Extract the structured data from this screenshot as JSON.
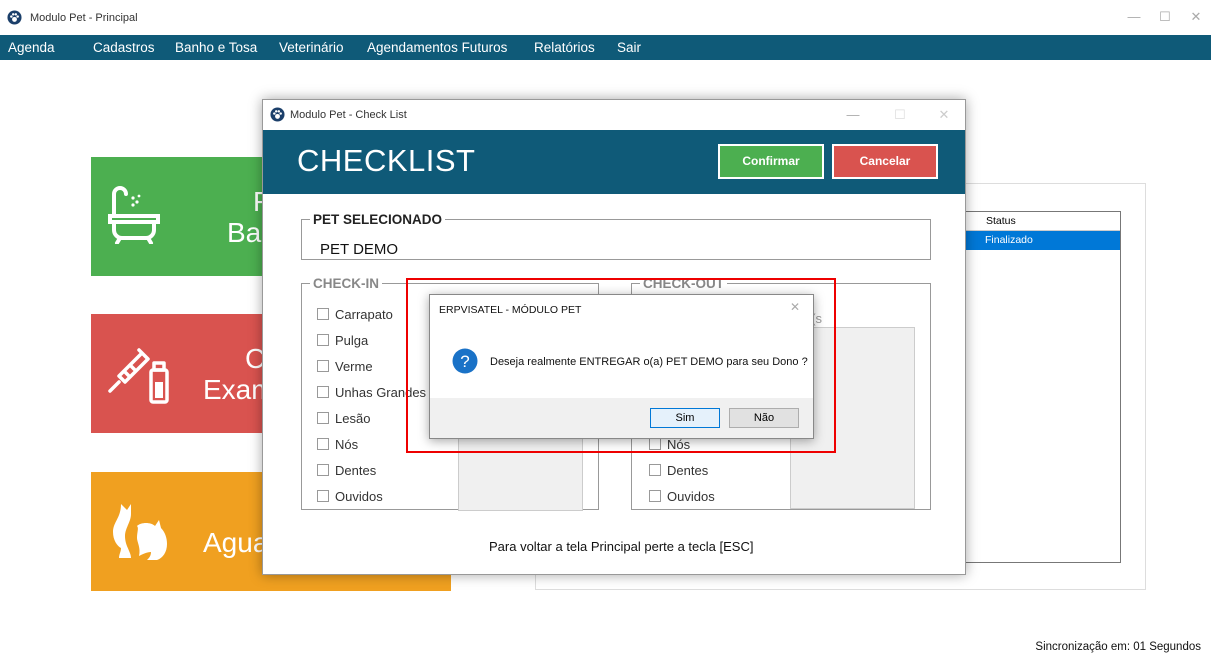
{
  "app": {
    "title": "Modulo Pet - Principal",
    "window_controls": {
      "minimize": "—",
      "maximize": "☐",
      "close": "✕"
    }
  },
  "menu": {
    "items": [
      "Agenda",
      "Cadastros",
      "Banho e Tosa",
      "Veterinário",
      "Agendamentos Futuros",
      "Relatórios",
      "Sair"
    ]
  },
  "tiles": [
    {
      "color": "#4caf50",
      "icon": "bathtub-icon",
      "line1": "F",
      "line2": "Ba"
    },
    {
      "color": "#d9534f",
      "icon": "vaccine-bottle-icon",
      "line1": "C",
      "line2": "Exam"
    },
    {
      "color": "#f0a020",
      "icon": "pets-icon",
      "line1": "Agua",
      "line2": ""
    }
  ],
  "grid": {
    "header": "Status",
    "rows": [
      "Finalizado"
    ],
    "selected_color": "#0078d7"
  },
  "checklist": {
    "title": "Modulo Pet - Check List",
    "heading": "CHECKLIST",
    "confirm_label": "Confirmar",
    "cancel_label": "Cancelar",
    "confirm_color": "#4caf50",
    "cancel_color": "#d9534f",
    "header_color": "#0f5a78",
    "pet_section": {
      "legend": "PET SELECIONADO",
      "value": "PET DEMO"
    },
    "checkin": {
      "legend": "CHECK-IN",
      "items": [
        "Carrapato",
        "Pulga",
        "Verme",
        "Unhas Grandes",
        "Lesão",
        "Nós",
        "Dentes",
        "Ouvidos"
      ]
    },
    "checkout": {
      "legend": "CHECK-OUT",
      "partial_label": "o(s",
      "visible_items": [
        "Nós",
        "Dentes",
        "Ouvidos"
      ]
    },
    "esc_hint": "Para voltar a tela Principal perte a tecla [ESC]"
  },
  "messagebox": {
    "title": "ERPVISATEL - MÓDULO PET",
    "message": "Deseja realmente ENTREGAR o(a) PET DEMO para seu Dono ?",
    "icon": "question-icon",
    "yes_label": "Sim",
    "no_label": "Não",
    "close_glyph": "✕"
  },
  "status": {
    "sync_text": "Sincronização em: 01 Segundos"
  }
}
